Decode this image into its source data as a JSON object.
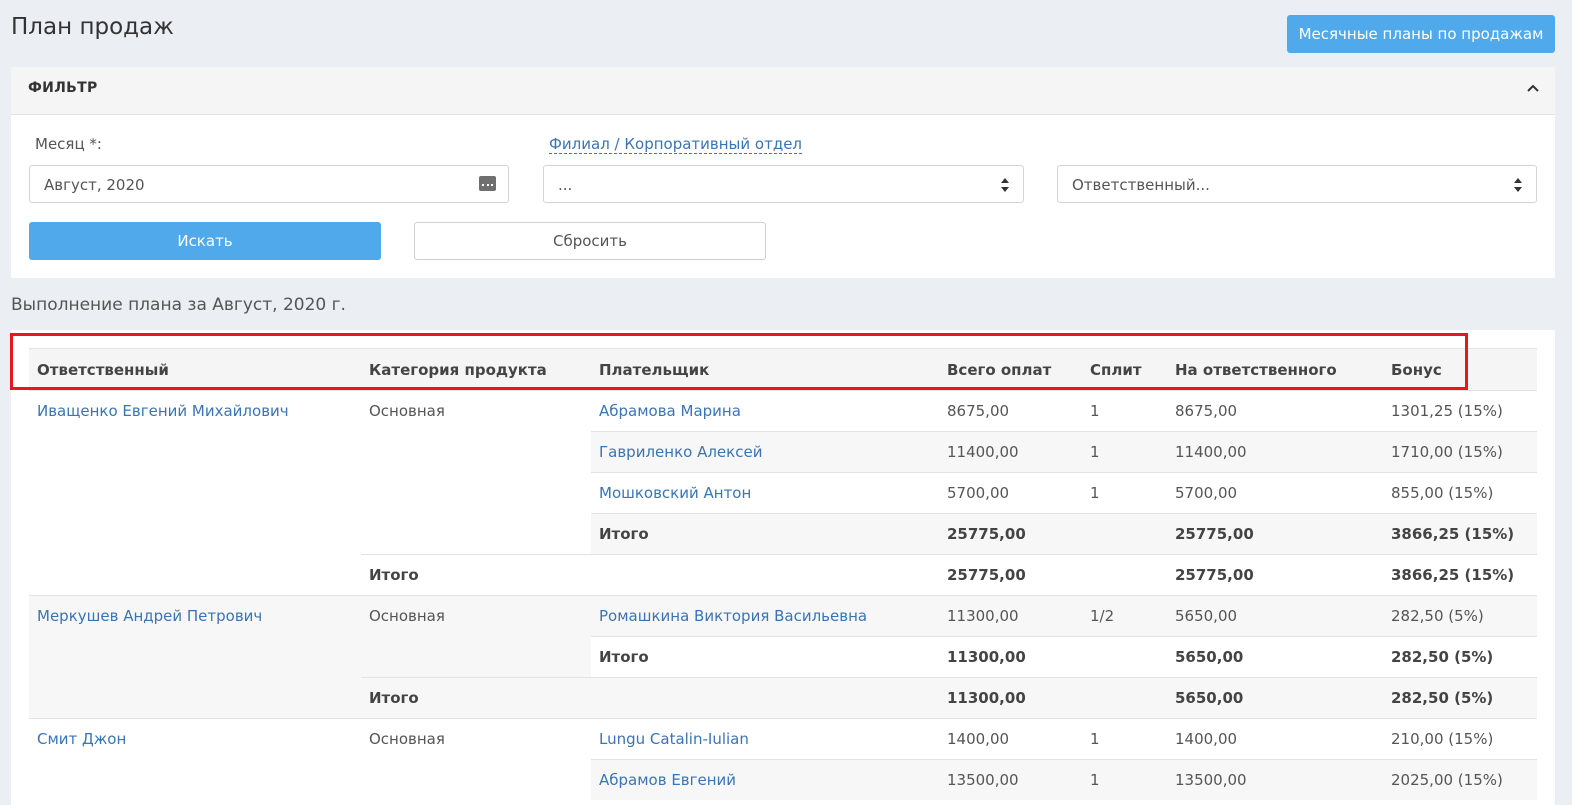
{
  "header": {
    "title": "План продаж",
    "monthly_plans_button": "Месячные планы по продажам"
  },
  "filter": {
    "title": "ФИЛЬТР",
    "month_label": "Месяц *:",
    "month_value": "Август, 2020",
    "branch_label": "Филиал / Корпоративный отдел",
    "branch_value": "...",
    "responsible_value": "Ответственный...",
    "search_button": "Искать",
    "reset_button": "Сбросить"
  },
  "report": {
    "title": "Выполнение плана за Август, 2020 г.",
    "columns": [
      "Ответственный",
      "Категория продукта",
      "Плательщик",
      "Всего оплат",
      "Сплит",
      "На ответственного",
      "Бонус"
    ],
    "total_label": "Итого",
    "groups": [
      {
        "responsible": "Иващенко Евгений Михайлович",
        "category": "Основная",
        "rows": [
          {
            "payer": "Абрамова Марина",
            "total": "8675,00",
            "split": "1",
            "on_responsible": "8675,00",
            "bonus": "1301,25 (15%)"
          },
          {
            "payer": "Гавриленко Алексей",
            "total": "11400,00",
            "split": "1",
            "on_responsible": "11400,00",
            "bonus": "1710,00 (15%)"
          },
          {
            "payer": "Мошковский Антон",
            "total": "5700,00",
            "split": "1",
            "on_responsible": "5700,00",
            "bonus": "855,00 (15%)"
          }
        ],
        "category_total": {
          "total": "25775,00",
          "on_responsible": "25775,00",
          "bonus": "3866,25 (15%)"
        },
        "responsible_total": {
          "total": "25775,00",
          "on_responsible": "25775,00",
          "bonus": "3866,25 (15%)"
        }
      },
      {
        "responsible": "Меркушев Андрей Петрович",
        "category": "Основная",
        "rows": [
          {
            "payer": "Ромашкина Виктория Васильевна",
            "total": "11300,00",
            "split": "1/2",
            "on_responsible": "5650,00",
            "bonus": "282,50 (5%)"
          }
        ],
        "category_total": {
          "total": "11300,00",
          "on_responsible": "5650,00",
          "bonus": "282,50 (5%)"
        },
        "responsible_total": {
          "total": "11300,00",
          "on_responsible": "5650,00",
          "bonus": "282,50 (5%)"
        }
      },
      {
        "responsible": "Смит Джон",
        "category": "Основная",
        "rows": [
          {
            "payer": "Lungu Catalin-Iulian",
            "total": "1400,00",
            "split": "1",
            "on_responsible": "1400,00",
            "bonus": "210,00 (15%)"
          },
          {
            "payer": "Абрамов Евгений",
            "total": "13500,00",
            "split": "1",
            "on_responsible": "13500,00",
            "bonus": "2025,00 (15%)"
          }
        ]
      }
    ]
  },
  "colors": {
    "accent": "#4fa9ea",
    "link": "#3a74b4",
    "highlight": "#e8171c",
    "background": "#ebeef3"
  }
}
